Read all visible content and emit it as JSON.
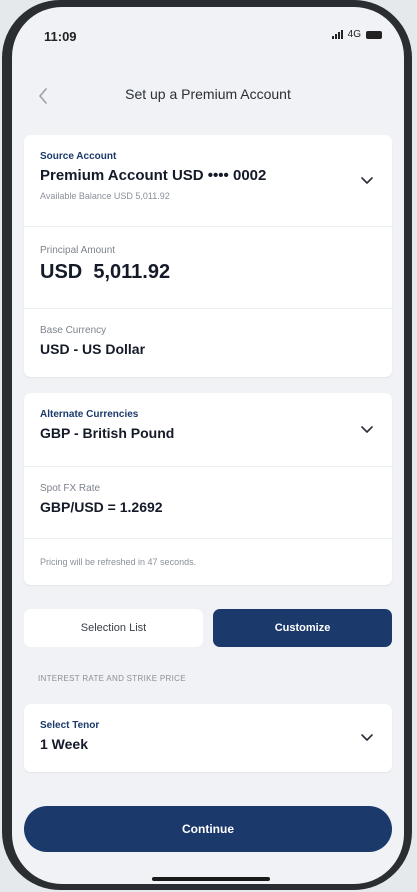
{
  "status": {
    "time": "11:09",
    "network": "4G"
  },
  "header": {
    "back_icon": "chevron-left-icon",
    "title": "Set up a Premium Account"
  },
  "account_card": {
    "source_label": "Source Account",
    "source_value": "Premium Account USD •••• 0002",
    "available_balance": "Available Balance USD 5,011.92",
    "principal_label": "Principal Amount",
    "principal_value": "USD  5,011.92",
    "base_label": "Base Currency",
    "base_value": "USD - US Dollar"
  },
  "fx_card": {
    "alt_label": "Alternate Currencies",
    "alt_value": "GBP - British Pound",
    "spot_label": "Spot FX Rate",
    "spot_value": "GBP/USD = 1.2692",
    "pricing_note": "Pricing will be refreshed in 47 seconds."
  },
  "segmented": {
    "option_1": "Selection List",
    "option_2": "Customize",
    "selected": "Customize"
  },
  "section_heading": "INTEREST RATE AND STRIKE PRICE",
  "tenor_card": {
    "label": "Select Tenor",
    "value": "1 Week"
  },
  "footer": {
    "continue_label": "Continue"
  },
  "colors": {
    "primary": "#1b3a6b",
    "background": "#f0f2f5",
    "card": "#ffffff"
  }
}
